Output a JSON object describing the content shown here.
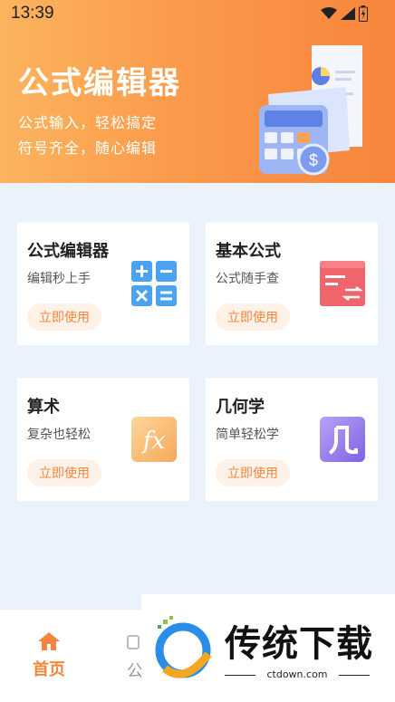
{
  "status_bar": {
    "time": "13:39"
  },
  "header": {
    "title": "公式编辑器",
    "line1": "公式输入，轻松搞定",
    "line2": "符号齐全，随心编辑"
  },
  "cards": [
    {
      "title": "公式编辑器",
      "subtitle": "编辑秒上手",
      "button": "立即使用",
      "icon": "calculator-ops-icon"
    },
    {
      "title": "基本公式",
      "subtitle": "公式随手查",
      "button": "立即使用",
      "icon": "formula-list-icon"
    },
    {
      "title": "算术",
      "subtitle": "复杂也轻松",
      "button": "立即使用",
      "icon": "fx-icon"
    },
    {
      "title": "几何学",
      "subtitle": "简单轻松学",
      "button": "立即使用",
      "icon": "geometry-ji-icon"
    }
  ],
  "bottom_nav": {
    "home_label": "首页",
    "second_label": "公"
  },
  "watermark": {
    "text": "传统下载",
    "url": "ctdown.com"
  },
  "colors": {
    "accent": "#f2863e",
    "header_start": "#fcb45e",
    "header_end": "#f7853c",
    "background": "#eaf3fc"
  }
}
